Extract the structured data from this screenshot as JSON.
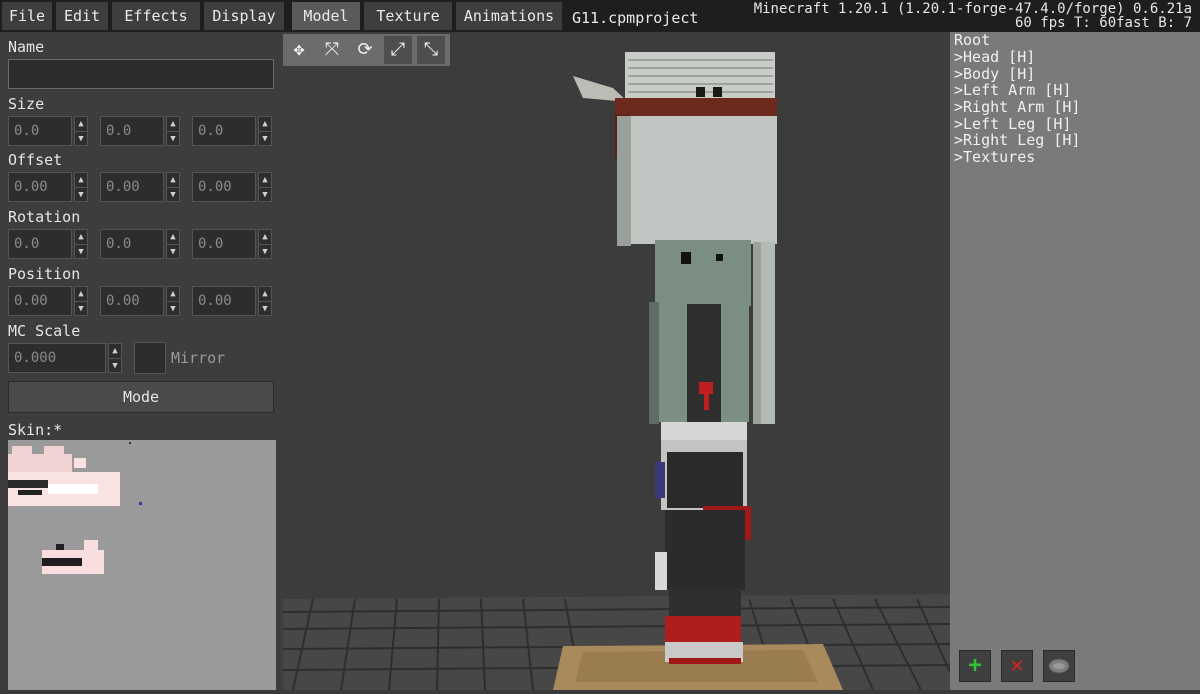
{
  "menubar": {
    "items": [
      {
        "label": "File"
      },
      {
        "label": "Edit"
      },
      {
        "label": "Effects"
      },
      {
        "label": "Display"
      },
      {
        "label": "Model"
      },
      {
        "label": "Texture"
      },
      {
        "label": "Animations"
      }
    ],
    "project_name": "G11.cpmproject",
    "version_line1": "Minecraft 1.20.1 (1.20.1-forge-47.4.0/forge) 0.6.21a",
    "version_line2": "60 fps T: 60fast B: 7"
  },
  "left_panel": {
    "name_label": "Name",
    "name_value": "",
    "size_label": "Size",
    "size_values": [
      "0.0",
      "0.0",
      "0.0"
    ],
    "offset_label": "Offset",
    "offset_values": [
      "0.00",
      "0.00",
      "0.00"
    ],
    "rotation_label": "Rotation",
    "rotation_values": [
      "0.0",
      "0.0",
      "0.0"
    ],
    "position_label": "Position",
    "position_values": [
      "0.00",
      "0.00",
      "0.00"
    ],
    "mc_scale_label": "MC Scale",
    "mc_scale_value": "0.000",
    "mirror_label": "Mirror",
    "mode_button": "Mode",
    "skin_label": "Skin:*"
  },
  "tools": [
    {
      "icon": "move-icon"
    },
    {
      "icon": "resize-icon"
    },
    {
      "icon": "rotate-icon"
    },
    {
      "icon": "offset-icon"
    },
    {
      "icon": "scale-icon"
    }
  ],
  "tree": {
    "root_label": "Root",
    "items": [
      {
        "label": "Head [H]"
      },
      {
        "label": "Body [H]"
      },
      {
        "label": "Left Arm [H]"
      },
      {
        "label": "Right Arm [H]"
      },
      {
        "label": "Left Leg [H]"
      },
      {
        "label": "Right Leg [H]"
      },
      {
        "label": "Textures"
      }
    ],
    "chevron": ">"
  },
  "actions": {
    "add_icon": "plus-icon",
    "delete_icon": "x-icon",
    "visibility_icon": "eye-icon"
  },
  "colors": {
    "add_green": "#35c135",
    "delete_red": "#d22424",
    "panel_dark": "#3d3d3d",
    "tree_bg": "#7a7a7a"
  }
}
